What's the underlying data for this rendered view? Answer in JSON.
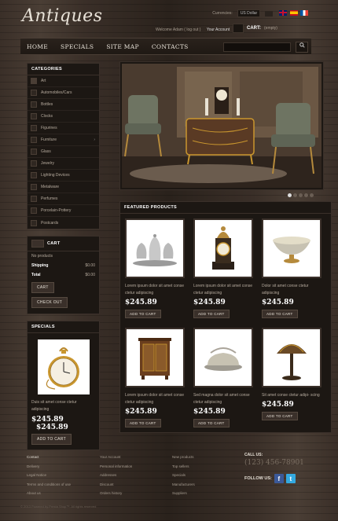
{
  "header": {
    "logo": "Antiques",
    "currencies_label": "Currencies:",
    "currency_value": "US Dollar",
    "welcome": "Welcome Adam ( log out )",
    "your_account": "Your Account",
    "cart_label": "CART:",
    "cart_value": "(empty)"
  },
  "nav": {
    "items": [
      "HOME",
      "SPECIALS",
      "SITE MAP",
      "CONTACTS"
    ],
    "search_icon": "search-icon"
  },
  "categories": {
    "title": "CATEGORIES",
    "items": [
      "Art",
      "Automobiles/Cars",
      "Bottles",
      "Clocks",
      "Figurines",
      "Furniture",
      "Glass",
      "Jewelry",
      "Lighting Devices",
      "Metalware",
      "Perfumes",
      "Porcelain-Pottery",
      "Postcards"
    ]
  },
  "cart": {
    "title": "CART",
    "no_products": "No products",
    "shipping_label": "Shipping",
    "shipping_value": "$0.00",
    "total_label": "Total",
    "total_value": "$0.00",
    "cart_button": "CART",
    "checkout_button": "CHECK OUT"
  },
  "specials": {
    "title": "SPECIALS",
    "desc": "Duis sit amet conse ctetur adipiscing",
    "price": "$245.89",
    "old_price": "$245.89",
    "button": "ADD TO CART"
  },
  "featured": {
    "title": "FEATURED PRODUCTS",
    "products": [
      {
        "desc": "Lorem ipsum dolor sit amet conse ctetur adipiscing",
        "price": "$245.89",
        "button": "ADD TO CART"
      },
      {
        "desc": "Lorem ipsum dolor sit amet conse ctetur adipiscing",
        "price": "$245.89",
        "button": "ADD TO CART"
      },
      {
        "desc": "Dolor sit amet conse ctetur adipiscing",
        "price": "$245.89",
        "button": "ADD TO CART"
      },
      {
        "desc": "Lorem ipsum dolor sit amet conse ctetur adipiscing",
        "price": "$245.89",
        "button": "ADD TO CART"
      },
      {
        "desc": "Sed magna dolor sit amet conse ctetur adipiscing",
        "price": "$245.89",
        "button": "ADD TO CART"
      },
      {
        "desc": "Sit amet conse ctetur adipi- scing",
        "price": "$245.89",
        "button": "ADD TO CART"
      }
    ]
  },
  "footer": {
    "col1": [
      "Contact",
      "Delivery",
      "Legal Notice",
      "Terms and conditions of use",
      "About us"
    ],
    "col2": [
      "Your Account",
      "Personal information",
      "Addresses",
      "Discount",
      "Orders history"
    ],
    "col3": [
      "New products",
      "Top sellers",
      "Specials",
      "Manufacturers",
      "Suppliers"
    ],
    "call_us": "CALL US:",
    "phone": "(123) 456-78901",
    "follow_us": "FOLLOW US:",
    "copyright": "© 2013 Powered by Presta Shop™. All rights reserved"
  }
}
